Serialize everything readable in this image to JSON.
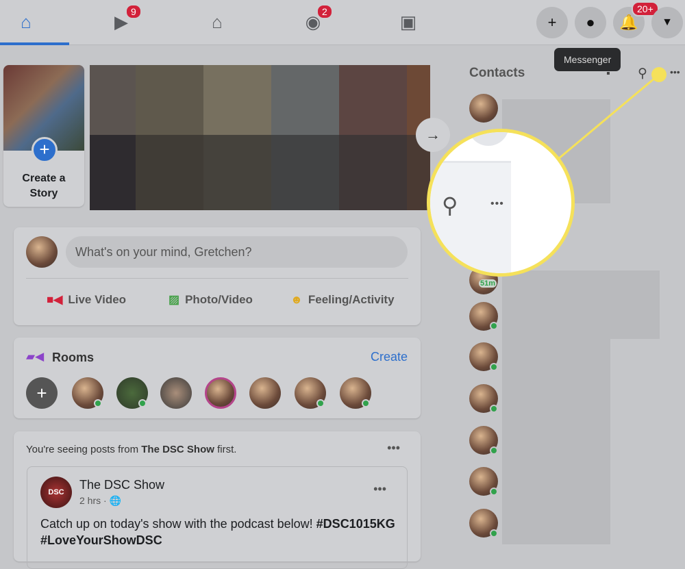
{
  "topnav": {
    "watch_badge": "9",
    "groups_badge": "2",
    "notifications_badge": "20+",
    "tooltip": "Messenger"
  },
  "stories": {
    "create_label": "Create a Story"
  },
  "composer": {
    "placeholder": "What's on your mind, Gretchen?",
    "actions": [
      {
        "label": "Live Video",
        "color": "#d2213a"
      },
      {
        "label": "Photo/Video",
        "color": "#45a047"
      },
      {
        "label": "Feeling/Activity",
        "color": "#e0a91e"
      }
    ]
  },
  "rooms": {
    "title": "Rooms",
    "create": "Create"
  },
  "feed": {
    "notice_prefix": "You're seeing posts from ",
    "notice_page": "The DSC Show",
    "notice_suffix": " first.",
    "post": {
      "author": "The DSC Show",
      "time": "2 hrs · ",
      "text": "Catch up on today's show with the podcast below! ",
      "tags": "#DSC1015KG #LoveYourShowDSC",
      "avatar_text": "DSC"
    }
  },
  "contacts": {
    "title": "Contacts",
    "status_51m": "51m"
  },
  "colors": {
    "accent": "#2d6fcc",
    "highlight": "#f5e15a",
    "online": "#31a24c"
  }
}
